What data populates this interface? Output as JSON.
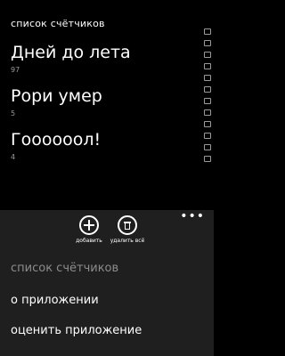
{
  "page_title": "список счётчиков",
  "counters": [
    {
      "name": "Дней до лета",
      "value": "97"
    },
    {
      "name": "Рори умер",
      "value": "5"
    },
    {
      "name": "Гоооооол!",
      "value": "4"
    }
  ],
  "app_bar": {
    "buttons": [
      {
        "icon": "add-icon",
        "label": "добавить"
      },
      {
        "icon": "trash-icon",
        "label": "удалить всё"
      }
    ],
    "more_label": "•••",
    "menu": [
      {
        "label": "список счётчиков",
        "enabled": false
      },
      {
        "label": "о приложении",
        "enabled": true
      },
      {
        "label": "оценить приложение",
        "enabled": true
      }
    ]
  }
}
